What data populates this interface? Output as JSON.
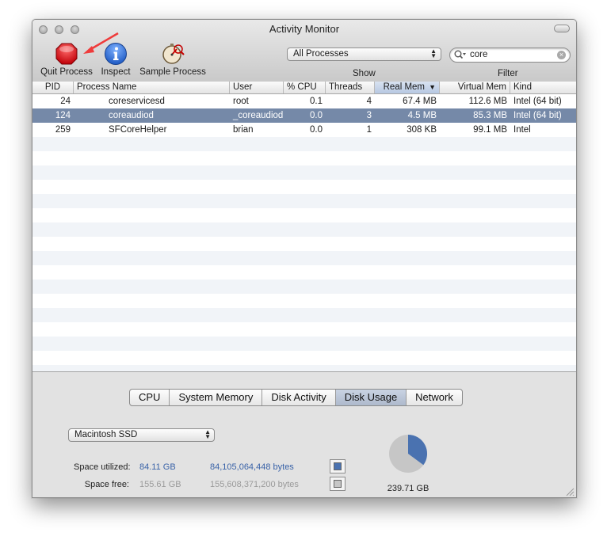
{
  "window": {
    "title": "Activity Monitor"
  },
  "toolbar": {
    "quit_label": "Quit Process",
    "inspect_label": "Inspect",
    "sample_label": "Sample Process",
    "show_popup_value": "All Processes",
    "show_label": "Show",
    "filter_label": "Filter",
    "search_value": "core"
  },
  "table": {
    "columns": [
      "PID",
      "Process Name",
      "User",
      "% CPU",
      "Threads",
      "Real Mem",
      "Virtual Mem",
      "Kind"
    ],
    "sorted_column": "Real Mem",
    "rows": [
      {
        "pid": "24",
        "name": "coreservicesd",
        "user": "root",
        "cpu": "0.1",
        "threads": "4",
        "real_mem": "67.4 MB",
        "virtual_mem": "112.6 MB",
        "kind": "Intel (64 bit)"
      },
      {
        "pid": "124",
        "name": "coreaudiod",
        "user": "_coreaudiod",
        "cpu": "0.0",
        "threads": "3",
        "real_mem": "4.5 MB",
        "virtual_mem": "85.3 MB",
        "kind": "Intel (64 bit)"
      },
      {
        "pid": "259",
        "name": "SFCoreHelper",
        "user": "brian",
        "cpu": "0.0",
        "threads": "1",
        "real_mem": "308 KB",
        "virtual_mem": "99.1 MB",
        "kind": "Intel"
      }
    ],
    "selected_row": 1
  },
  "tabs": [
    "CPU",
    "System Memory",
    "Disk Activity",
    "Disk Usage",
    "Network"
  ],
  "active_tab": "Disk Usage",
  "disk": {
    "selected_disk": "Macintosh SSD",
    "utilized_label": "Space utilized:",
    "utilized_gb": "84.11 GB",
    "utilized_bytes": "84,105,064,448 bytes",
    "free_label": "Space free:",
    "free_gb": "155.61 GB",
    "free_bytes": "155,608,371,200 bytes",
    "total": "239.71 GB",
    "used_fraction": 0.3509
  },
  "colors": {
    "selection": "#7589a8",
    "used": "#4a72b0",
    "free": "#c6c6c6",
    "quit_button": "#e8141b",
    "inspect_button": "#2b6fd8"
  }
}
